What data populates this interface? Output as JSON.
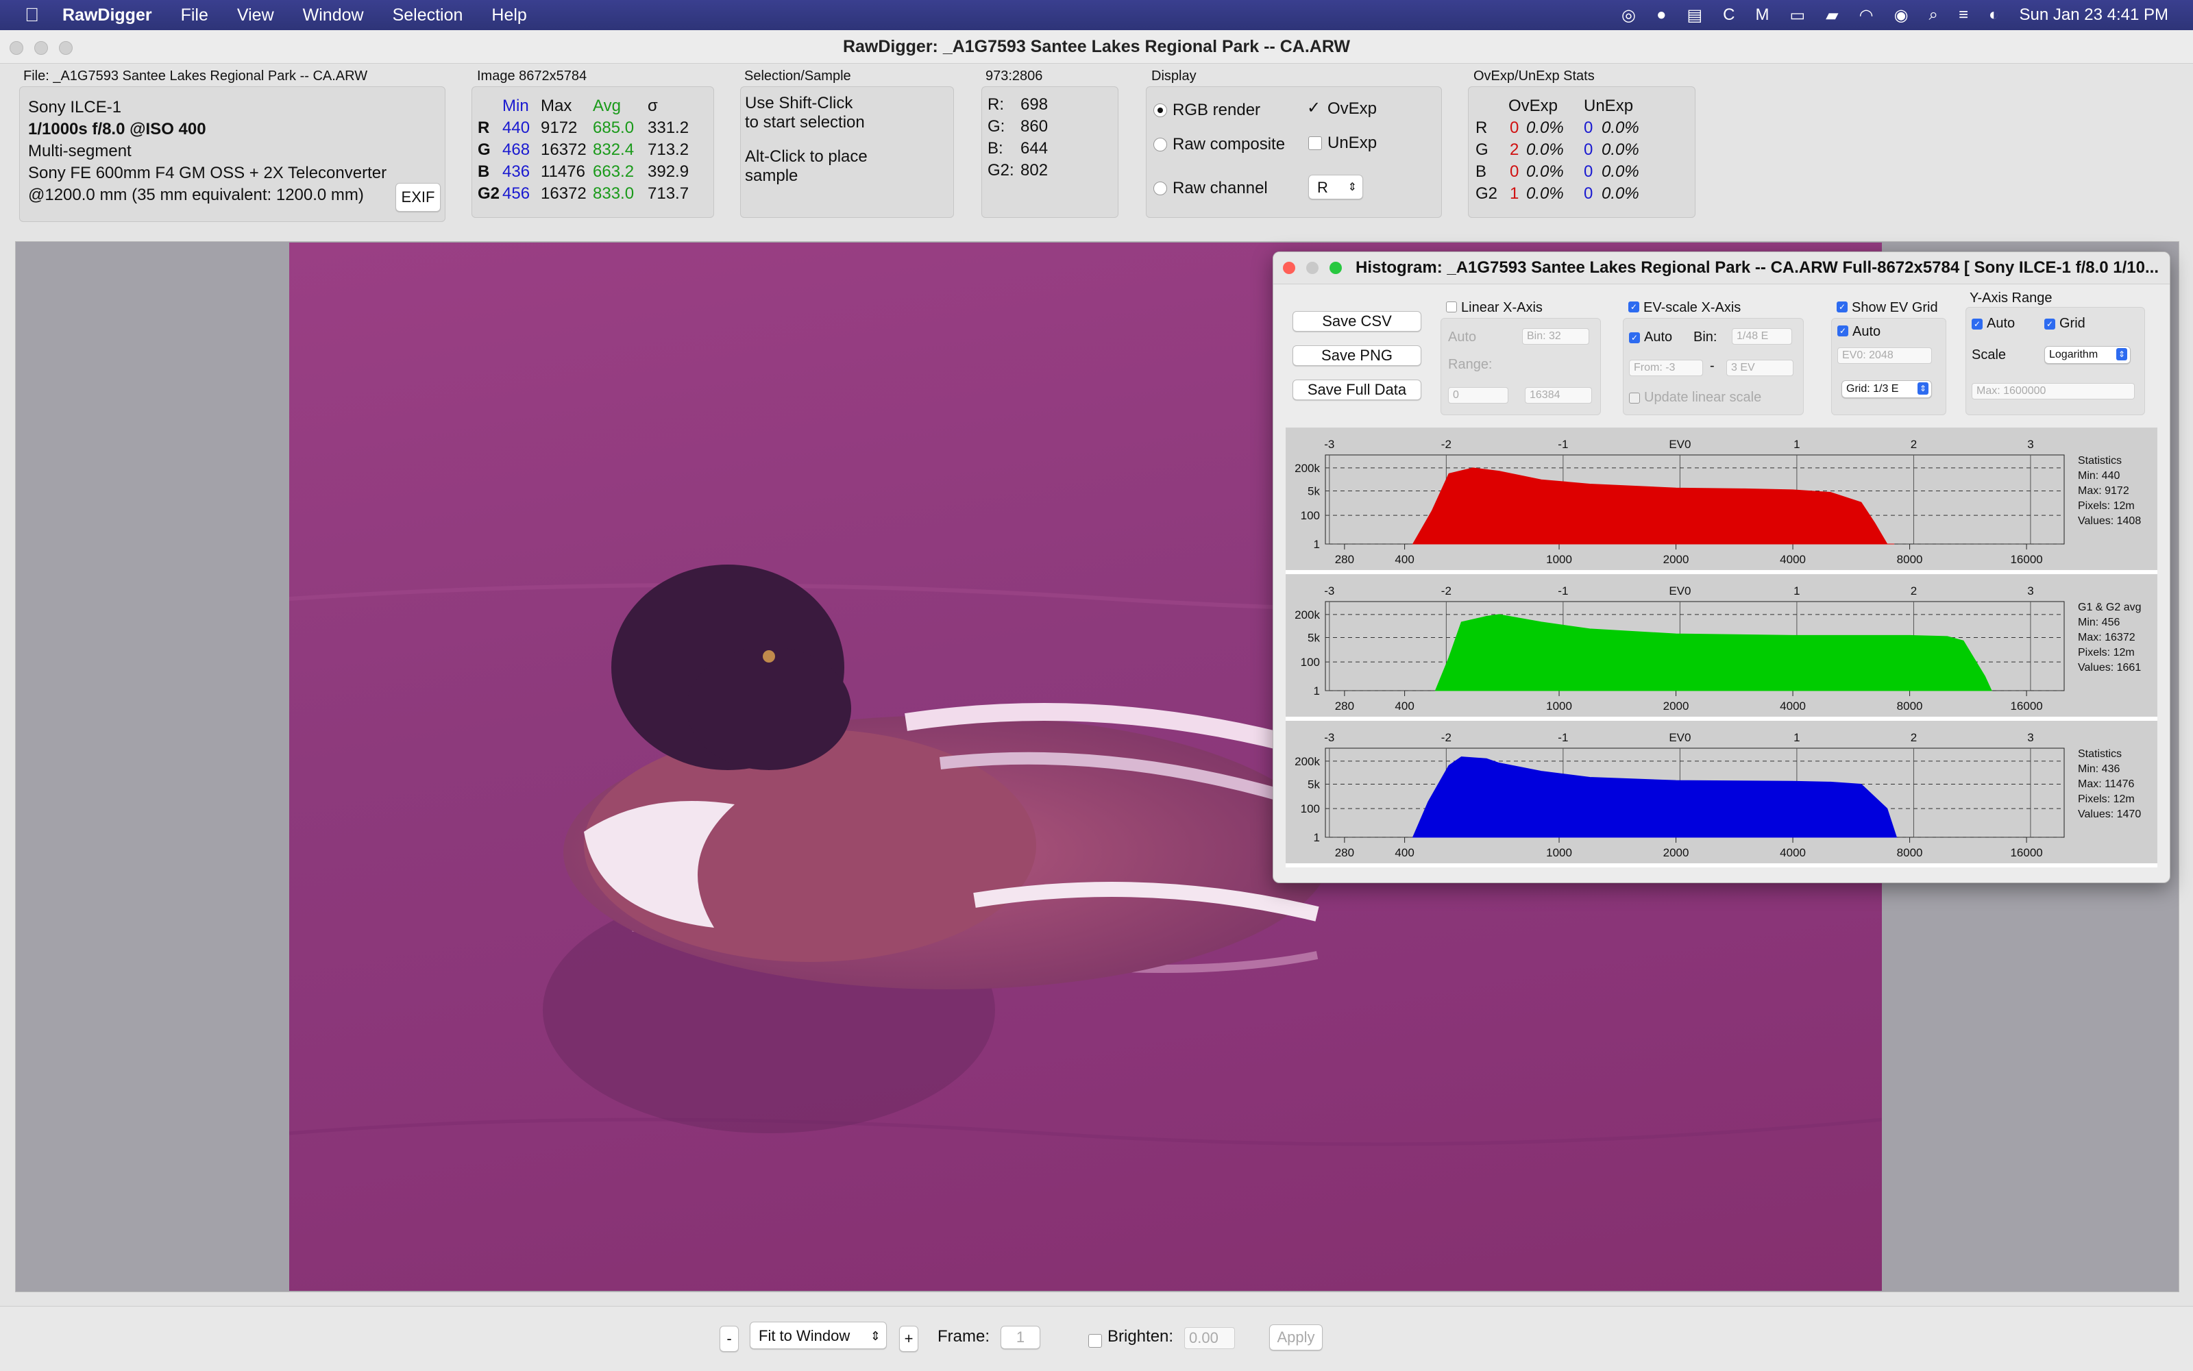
{
  "menubar": {
    "app": "RawDigger",
    "items": [
      "File",
      "View",
      "Window",
      "Selection",
      "Help"
    ],
    "clock": "Sun Jan 23  4:41 PM"
  },
  "window": {
    "title": "RawDigger: _A1G7593 Santee Lakes Regional Park  -- CA.ARW"
  },
  "file": {
    "header": "File: _A1G7593 Santee Lakes Regional Park  -- CA.ARW",
    "camera": "Sony ILCE-1",
    "exposure": "1/1000s f/8.0 @ISO 400",
    "mode": "Multi-segment",
    "lens": "Sony FE 600mm F4 GM OSS + 2X Teleconverter",
    "focal": "@1200.0 mm (35 mm equivalent: 1200.0 mm)",
    "exif_label": "EXIF"
  },
  "image_stats": {
    "header": "Image 8672x5784",
    "cols": [
      "Min",
      "Max",
      "Avg",
      "σ"
    ],
    "rows": [
      {
        "ch": "R",
        "min": "440",
        "max": "9172",
        "avg": "685.0",
        "sd": "331.2"
      },
      {
        "ch": "G",
        "min": "468",
        "max": "16372",
        "avg": "832.4",
        "sd": "713.2"
      },
      {
        "ch": "B",
        "min": "436",
        "max": "11476",
        "avg": "663.2",
        "sd": "392.9"
      },
      {
        "ch": "G2",
        "min": "456",
        "max": "16372",
        "avg": "833.0",
        "sd": "713.7"
      }
    ]
  },
  "selection": {
    "header": "Selection/Sample",
    "line1": "Use Shift-Click",
    "line2": "to start selection",
    "line3": "Alt-Click to place",
    "line4": "sample"
  },
  "sample": {
    "header": "973:2806",
    "r_label": "R:",
    "r": "698",
    "g_label": "G:",
    "g": "860",
    "b_label": "B:",
    "b": "644",
    "g2_label": "G2:",
    "g2": "802"
  },
  "display": {
    "header": "Display",
    "rgb": "RGB render",
    "raw_comp": "Raw composite",
    "raw_chan": "Raw channel",
    "chan_value": "R",
    "ovexp": "OvExp",
    "unexp": "UnExp"
  },
  "ovstats": {
    "header": "OvExp/UnExp Stats",
    "col1": "OvExp",
    "col2": "UnExp",
    "rows": [
      {
        "ch": "R",
        "ov": "0",
        "ovp": "0.0%",
        "un": "0",
        "unp": "0.0%"
      },
      {
        "ch": "G",
        "ov": "2",
        "ovp": "0.0%",
        "un": "0",
        "unp": "0.0%"
      },
      {
        "ch": "B",
        "ov": "0",
        "ovp": "0.0%",
        "un": "0",
        "unp": "0.0%"
      },
      {
        "ch": "G2",
        "ov": "1",
        "ovp": "0.0%",
        "un": "0",
        "unp": "0.0%"
      }
    ]
  },
  "histogram": {
    "title": "Histogram: _A1G7593 Santee Lakes Regional Park  -- CA.ARW Full-8672x5784 [ Sony ILCE-1 f/8.0 1/10...",
    "save_csv": "Save CSV",
    "save_png": "Save PNG",
    "save_full": "Save Full Data",
    "linear_x": "Linear X-Axis",
    "auto": "Auto",
    "bin32": "Bin: 32",
    "range": "Range:",
    "range_from": "0",
    "range_to": "16384",
    "ev_scale": "EV-scale X-Axis",
    "bin_label": "Bin:",
    "bin_value": "1/48 E",
    "from": "From: -3",
    "to": "3 EV",
    "update_linear": "Update linear scale",
    "show_ev_grid": "Show EV Grid",
    "ev0": "EV0: 2048",
    "grid_value": "Grid: 1/3 E",
    "y_range": "Y-Axis Range",
    "grid": "Grid",
    "scale": "Scale",
    "scale_value": "Logarithm",
    "ymax": "Max: 1600000",
    "ev_ticks": [
      "-3",
      "-2",
      "-1",
      "EV0",
      "1",
      "2",
      "3"
    ],
    "x_ticks": [
      "280",
      "400",
      "1000",
      "2000",
      "4000",
      "8000",
      "16000"
    ],
    "y_ticks": [
      "200k",
      "5k",
      "100",
      "1"
    ],
    "panels": [
      {
        "stats": [
          "Statistics",
          "Min: 440",
          "Max: 9172",
          "Pixels: 12m",
          "Values: 1408"
        ],
        "color": "#dd0000"
      },
      {
        "stats": [
          "G1 & G2 avg",
          "Min: 456",
          "Max: 16372",
          "Pixels: 12m",
          "Values: 1661"
        ],
        "color": "#00cc00"
      },
      {
        "stats": [
          "Statistics",
          "Min: 436",
          "Max: 11476",
          "Pixels: 12m",
          "Values: 1470"
        ],
        "color": "#0000dd"
      }
    ]
  },
  "chart_data": {
    "type": "area",
    "x_scale": "log",
    "xlim": [
      250,
      20000
    ],
    "y_scale": "log",
    "series": [
      {
        "x": [
          420,
          470,
          520,
          600,
          700,
          900,
          1200,
          2000,
          3000,
          4000,
          5000,
          6000,
          6500,
          7000,
          7300
        ],
        "y": [
          1,
          200,
          80000,
          200000,
          120000,
          30000,
          15000,
          8000,
          7000,
          6000,
          4000,
          800,
          30,
          1,
          0
        ]
      },
      {
        "x": [
          480,
          520,
          560,
          650,
          700,
          900,
          1200,
          2000,
          4000,
          8000,
          10000,
          11000,
          12500,
          13000
        ],
        "y": [
          1,
          200,
          60000,
          150000,
          200000,
          60000,
          20000,
          9000,
          7000,
          7000,
          6000,
          3000,
          10,
          1
        ]
      },
      {
        "x": [
          420,
          460,
          520,
          560,
          650,
          700,
          900,
          1200,
          2000,
          4000,
          5000,
          6000,
          7000,
          7400
        ],
        "y": [
          1,
          300,
          100000,
          400000,
          300000,
          150000,
          40000,
          15000,
          9000,
          8000,
          7000,
          5000,
          100,
          1
        ]
      }
    ]
  },
  "bottom": {
    "minus": "-",
    "fit": "Fit to Window",
    "plus": "+",
    "frame_label": "Frame:",
    "frame_value": "1",
    "brighten": "Brighten:",
    "brighten_value": "0.00",
    "apply": "Apply"
  }
}
